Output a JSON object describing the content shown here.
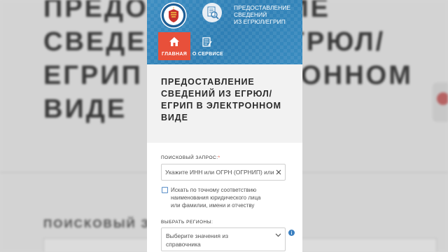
{
  "background": {
    "title_lines": [
      "ПРЕДОСТАВЛЕНИЕ",
      "СВЕДЕНИЙ ИЗ ЕГРЮЛ/",
      "ЕГРИП В ЭЛЕКТРОННОМ",
      "ВИДЕ"
    ],
    "search_label": "ПОИСКОВЫЙ ЗАПРОС:"
  },
  "header": {
    "title_lines": [
      "ПРЕДОСТАВЛЕНИЕ",
      "СВЕДЕНИЙ",
      "ИЗ ЕГРЮЛ/ЕГРИП"
    ],
    "logo_icon": "fns-emblem-icon",
    "service_icon": "search-document-icon"
  },
  "nav": {
    "home_label": "ГЛАВНАЯ",
    "about_label": "О СЕРВИСЕ"
  },
  "page": {
    "title_lines": [
      "ПРЕДОСТАВЛЕНИЕ",
      "СВЕДЕНИЙ ИЗ ЕГРЮЛ/",
      "ЕГРИП В ЭЛЕКТРОННОМ",
      "ВИДЕ"
    ]
  },
  "form": {
    "search_label": "ПОИСКОВЫЙ ЗАПРОС:",
    "required_mark": "*",
    "search_placeholder": "Укажите ИНН или ОГРН (ОГРНИП) или",
    "search_value": "",
    "exact_match_lines": [
      "Искать по точному соответствию",
      "наименования юридического лица",
      "или фамилии, имени и отчеству"
    ],
    "exact_match_checked": false,
    "region_label": "ВЫБРАТЬ РЕГИОНЫ:",
    "region_placeholder_lines": [
      "Выберите значения из",
      "справочника"
    ]
  },
  "colors": {
    "header_blue": "#3a8cc0",
    "accent_red": "#e8503a",
    "title_bg": "#f2f2f2"
  }
}
